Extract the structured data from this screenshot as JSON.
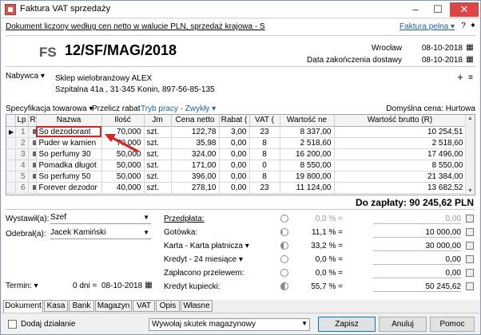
{
  "window": {
    "title": "Faktura VAT sprzedaży",
    "min": "–",
    "max": "☐",
    "close": "✕"
  },
  "header": {
    "info": "Dokument liczony według cen netto w walucie PLN, sprzedaż krajowa - S",
    "form_link": "Faktura pełna ▾",
    "doc_type": "FS",
    "doc_number": "12/SF/MAG/2018",
    "place": "Wrocław",
    "issue_date": "08-10-2018",
    "delivery_label": "Data zakończenia dostawy",
    "delivery_date": "08-10-2018"
  },
  "buyer": {
    "label": "Nabywca ▾",
    "name": "Sklep wielobranżowy  ALEX",
    "address": "Szpitalna  41a , 31-345 Konin, 897-56-85-135"
  },
  "toolbar": {
    "spec": "Specyfikacja towarowa ▾",
    "recalc": "Przelicz rabat",
    "mode": "Tryb pracy - Zwykły ▾",
    "default_price": "Domyślna cena: Hurtowa"
  },
  "table": {
    "headers": [
      "",
      "Lp",
      "R",
      "Nazwa",
      "Ilość",
      "Jm",
      "Cena netto",
      "Rabat (",
      "VAT (",
      "Wartość ne",
      "Wartość brutto (R)"
    ],
    "rows": [
      {
        "lp": "1",
        "name": "So dezodorant",
        "qty": "70,000",
        "unit": "szt.",
        "price": "122,78",
        "discount": "3,00",
        "vat": "23",
        "net": "8 337,00",
        "gross": "10 254,51"
      },
      {
        "lp": "2",
        "name": "Puder w kamien",
        "qty": "70,000",
        "unit": "szt.",
        "price": "35,98",
        "discount": "0,00",
        "vat": "8",
        "net": "2 518,60",
        "gross": "2 518,60"
      },
      {
        "lp": "3",
        "name": "So perfumy 30",
        "qty": "50,000",
        "unit": "szt.",
        "price": "324,00",
        "discount": "0,00",
        "vat": "8",
        "net": "16 200,00",
        "gross": "17 496,00"
      },
      {
        "lp": "4",
        "name": "Pomadka długot",
        "qty": "50,000",
        "unit": "szt.",
        "price": "171,00",
        "discount": "0,00",
        "vat": "0",
        "net": "8 550,00",
        "gross": "8 550,00"
      },
      {
        "lp": "5",
        "name": "So perfumy 50",
        "qty": "50,000",
        "unit": "szt.",
        "price": "396,00",
        "discount": "0,00",
        "vat": "8",
        "net": "19 800,00",
        "gross": "21 384,00"
      },
      {
        "lp": "6",
        "name": "Forever dezodor",
        "qty": "40,000",
        "unit": "szt.",
        "price": "278,10",
        "discount": "0,00",
        "vat": "23",
        "net": "11 124,00",
        "gross": "13 682,52"
      }
    ]
  },
  "total": "Do zapłaty: 90 245,62 PLN",
  "left_form": {
    "issued_label": "Wystawił(a):",
    "issued_value": "Szef",
    "received_label": "Odebrał(a):",
    "received_value": "Jacek Kamiński",
    "term_label": "Termin: ▾",
    "term_days": "0 dni =",
    "term_date": "08-10-2018"
  },
  "payments": [
    {
      "name": "Przedpłata:",
      "pct": "0,0 % =",
      "value": "0,00",
      "dim": true
    },
    {
      "name": "Gotówka:",
      "pct": "11,1 % =",
      "value": "10 000,00",
      "dim": false
    },
    {
      "name": "Karta - Karta płatnicza ▾",
      "pct": "33,2 % =",
      "value": "30 000,00",
      "dim": false
    },
    {
      "name": "Kredyt - 24 miesiące ▾",
      "pct": "0,0 % =",
      "value": "0,00",
      "dim": false
    },
    {
      "name": "Zapłacono przelewem:",
      "pct": "0,0 % =",
      "value": "0,00",
      "dim": false
    },
    {
      "name": "Kredyt kupiecki:",
      "pct": "55,7 % =",
      "value": "50 245,62",
      "dim": false
    }
  ],
  "tabs": [
    "Dokument",
    "Kasa",
    "Bank",
    "Magazyn",
    "VAT",
    "Opis",
    "Własne"
  ],
  "bottom": {
    "add_action": "Dodaj działanie",
    "magazine_select": "Wywołaj skutek magazynowy",
    "save": "Zapisz",
    "cancel": "Anuluj",
    "help": "Pomoc"
  }
}
